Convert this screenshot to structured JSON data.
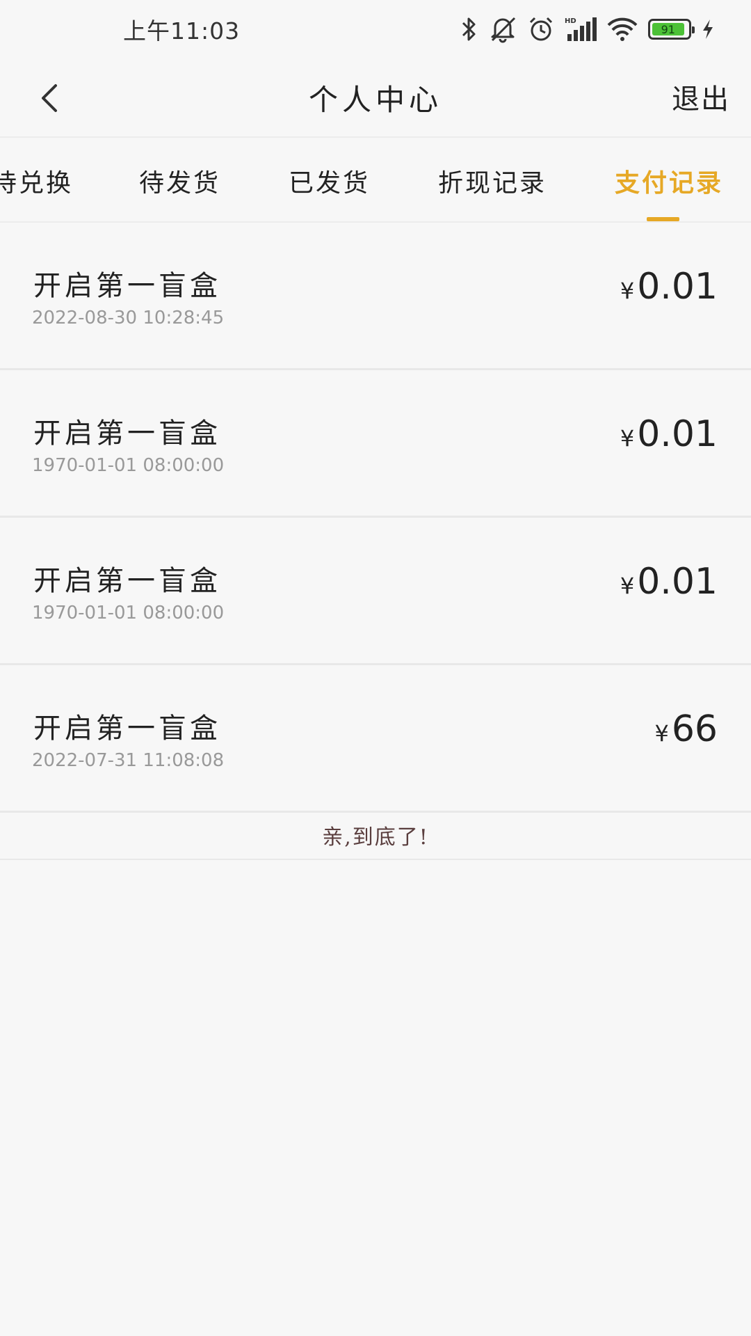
{
  "status_bar": {
    "time": "上午11:03",
    "battery_level": "91",
    "icons": [
      "bluetooth-icon",
      "mute-icon",
      "alarm-icon",
      "hd-signal-icon",
      "wifi-icon",
      "battery-icon",
      "charging-icon"
    ]
  },
  "header": {
    "title": "个人中心",
    "logout_label": "退出",
    "back_icon": "chevron-left-icon"
  },
  "tabs": [
    {
      "label": "待兑换",
      "active": false
    },
    {
      "label": "待发货",
      "active": false
    },
    {
      "label": "已发货",
      "active": false
    },
    {
      "label": "折现记录",
      "active": false
    },
    {
      "label": "支付记录",
      "active": true
    }
  ],
  "accent_color": "#e6a825",
  "records": [
    {
      "title": "开启第一盲盒",
      "time": "2022-08-30  10:28:45",
      "currency": "¥",
      "amount": "0.01"
    },
    {
      "title": "开启第一盲盒",
      "time": "1970-01-01  08:00:00",
      "currency": "¥",
      "amount": "0.01"
    },
    {
      "title": "开启第一盲盒",
      "time": "1970-01-01  08:00:00",
      "currency": "¥",
      "amount": "0.01"
    },
    {
      "title": "开启第一盲盒",
      "time": "2022-07-31  11:08:08",
      "currency": "¥",
      "amount": "66"
    }
  ],
  "list_end_text": "亲,到底了!"
}
